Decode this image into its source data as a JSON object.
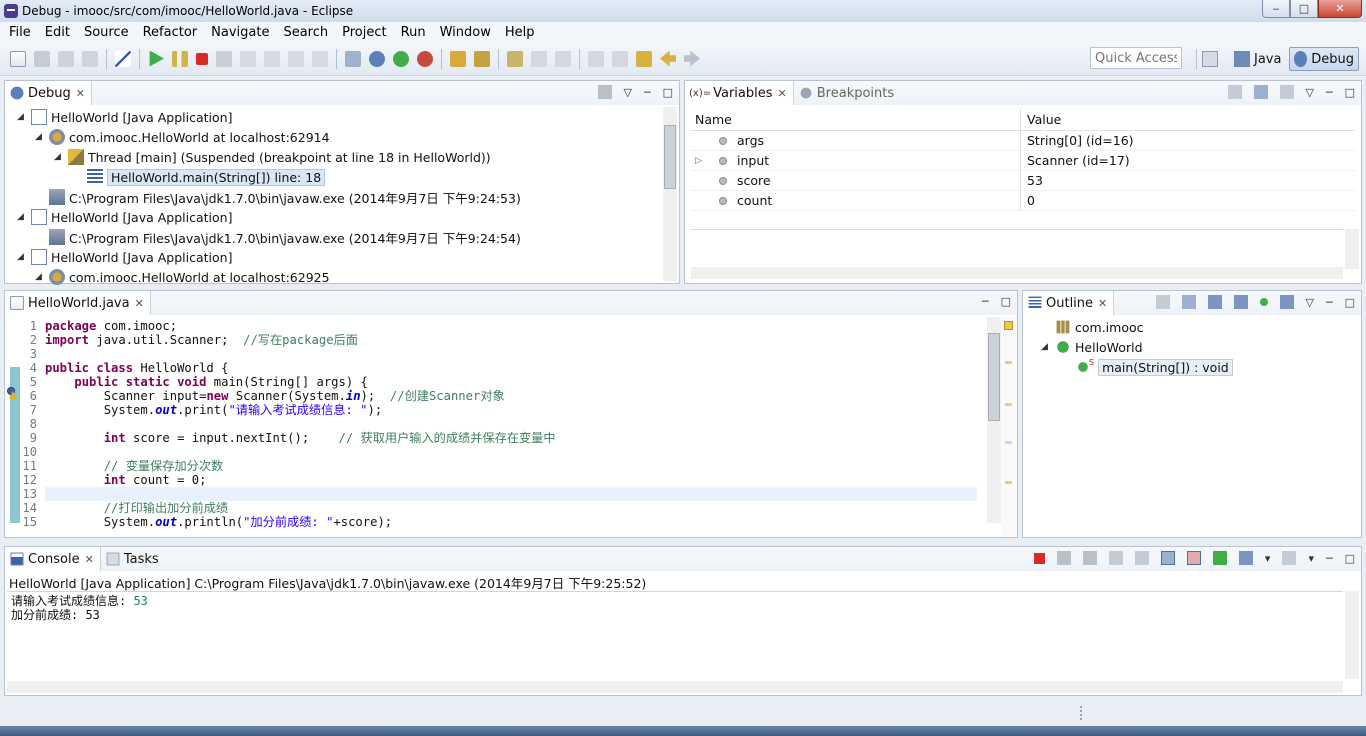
{
  "window": {
    "title": "Debug - imooc/src/com/imooc/HelloWorld.java - Eclipse",
    "buttons": {
      "minimize": "‒",
      "maximize": "□",
      "close": "✕"
    }
  },
  "menu": [
    "File",
    "Edit",
    "Source",
    "Refactor",
    "Navigate",
    "Search",
    "Project",
    "Run",
    "Window",
    "Help"
  ],
  "toolbar": {
    "quick_access_placeholder": "Quick Access",
    "perspectives": [
      {
        "label": "Java"
      },
      {
        "label": "Debug"
      }
    ]
  },
  "debug_view": {
    "tab": "Debug",
    "close": "✕",
    "tree": [
      {
        "twisty": "◢",
        "label": "HelloWorld [Java Application]"
      },
      {
        "twisty": "◢",
        "label": "com.imooc.HelloWorld at localhost:62914"
      },
      {
        "twisty": "◢",
        "label": "Thread [main] (Suspended (breakpoint at line 18 in HelloWorld))"
      },
      {
        "twisty": "",
        "label": "HelloWorld.main(String[]) line: 18"
      },
      {
        "twisty": "",
        "label": "C:\\Program Files\\Java\\jdk1.7.0\\bin\\javaw.exe (2014年9月7日 下午9:24:53)"
      },
      {
        "twisty": "◢",
        "label": "HelloWorld [Java Application]"
      },
      {
        "twisty": "",
        "label": "C:\\Program Files\\Java\\jdk1.7.0\\bin\\javaw.exe (2014年9月7日 下午9:24:54)"
      },
      {
        "twisty": "◢",
        "label": "HelloWorld [Java Application]"
      },
      {
        "twisty": "◢",
        "label": "com.imooc.HelloWorld at localhost:62925"
      }
    ]
  },
  "variables_view": {
    "tabs": [
      "Variables",
      "Breakpoints"
    ],
    "tab_prefix": "(x)=",
    "close": "✕",
    "columns": {
      "name": "Name",
      "value": "Value"
    },
    "rows": [
      {
        "twisty": "",
        "name": "args",
        "value": "String[0]  (id=16)"
      },
      {
        "twisty": "▷",
        "name": "input",
        "value": "Scanner  (id=17)"
      },
      {
        "twisty": "",
        "name": "score",
        "value": "53"
      },
      {
        "twisty": "",
        "name": "count",
        "value": "0"
      }
    ]
  },
  "editor": {
    "tab": "HelloWorld.java",
    "close": "✕",
    "lines": [
      {
        "n": "1",
        "segs": [
          {
            "c": "kw",
            "t": "package"
          },
          {
            "c": "",
            "t": " com.imooc;"
          }
        ]
      },
      {
        "n": "2",
        "segs": [
          {
            "c": "kw",
            "t": "import"
          },
          {
            "c": "",
            "t": " java.util.Scanner;  "
          },
          {
            "c": "cm",
            "t": "//写在package后面"
          }
        ]
      },
      {
        "n": "3",
        "segs": []
      },
      {
        "n": "4",
        "segs": [
          {
            "c": "kw",
            "t": "public class"
          },
          {
            "c": "",
            "t": " HelloWorld {"
          }
        ]
      },
      {
        "n": "5",
        "segs": [
          {
            "c": "",
            "t": "    "
          },
          {
            "c": "kw",
            "t": "public static void"
          },
          {
            "c": "",
            "t": " main(String[] args) {"
          }
        ]
      },
      {
        "n": "6",
        "segs": [
          {
            "c": "",
            "t": "        Scanner input="
          },
          {
            "c": "kw",
            "t": "new"
          },
          {
            "c": "",
            "t": " Scanner(System."
          },
          {
            "c": "fld",
            "t": "in"
          },
          {
            "c": "",
            "t": ");  "
          },
          {
            "c": "cm",
            "t": "//创建Scanner对象"
          }
        ]
      },
      {
        "n": "7",
        "segs": [
          {
            "c": "",
            "t": "        System."
          },
          {
            "c": "fld",
            "t": "out"
          },
          {
            "c": "",
            "t": ".print("
          },
          {
            "c": "st",
            "t": "\"请输入考试成绩信息: \""
          },
          {
            "c": "",
            "t": ");"
          }
        ]
      },
      {
        "n": "8",
        "segs": []
      },
      {
        "n": "9",
        "segs": [
          {
            "c": "",
            "t": "        "
          },
          {
            "c": "kw",
            "t": "int"
          },
          {
            "c": "",
            "t": " score = input.nextInt();    "
          },
          {
            "c": "cm",
            "t": "// 获取用户输入的成绩并保存在变量中"
          }
        ]
      },
      {
        "n": "10",
        "segs": []
      },
      {
        "n": "11",
        "segs": [
          {
            "c": "",
            "t": "        "
          },
          {
            "c": "cm",
            "t": "// 变量保存加分次数"
          }
        ]
      },
      {
        "n": "12",
        "segs": [
          {
            "c": "",
            "t": "        "
          },
          {
            "c": "kw",
            "t": "int"
          },
          {
            "c": "",
            "t": " count = 0;"
          }
        ]
      },
      {
        "n": "13",
        "segs": []
      },
      {
        "n": "14",
        "segs": [
          {
            "c": "",
            "t": "        "
          },
          {
            "c": "cm",
            "t": "//打印输出加分前成绩"
          }
        ]
      },
      {
        "n": "15",
        "segs": [
          {
            "c": "",
            "t": "        System."
          },
          {
            "c": "fld",
            "t": "out"
          },
          {
            "c": "",
            "t": ".println("
          },
          {
            "c": "st",
            "t": "\"加分前成绩: \""
          },
          {
            "c": "",
            "t": "+score);"
          }
        ]
      }
    ]
  },
  "outline_view": {
    "tab": "Outline",
    "close": "✕",
    "items": [
      {
        "twisty": "",
        "label": "com.imooc"
      },
      {
        "twisty": "◢",
        "label": "HelloWorld"
      },
      {
        "twisty": "",
        "label": "main(String[]) : void",
        "badge": "S"
      }
    ]
  },
  "console_view": {
    "tabs": [
      "Console",
      "Tasks"
    ],
    "close": "✕",
    "info": "HelloWorld [Java Application] C:\\Program Files\\Java\\jdk1.7.0\\bin\\javaw.exe (2014年9月7日 下午9:25:52)",
    "output": [
      {
        "text": "请输入考试成绩信息: ",
        "input": "53"
      },
      {
        "text": "加分前成绩: 53",
        "input": ""
      }
    ]
  },
  "colors": {
    "keyword": "#7f0055",
    "comment": "#3f7f5f",
    "string": "#2a00ff",
    "field": "#0000c0",
    "console_input": "#0f8a5f",
    "current_line": "#e8f2fe",
    "selection": "#d9e6f5"
  }
}
